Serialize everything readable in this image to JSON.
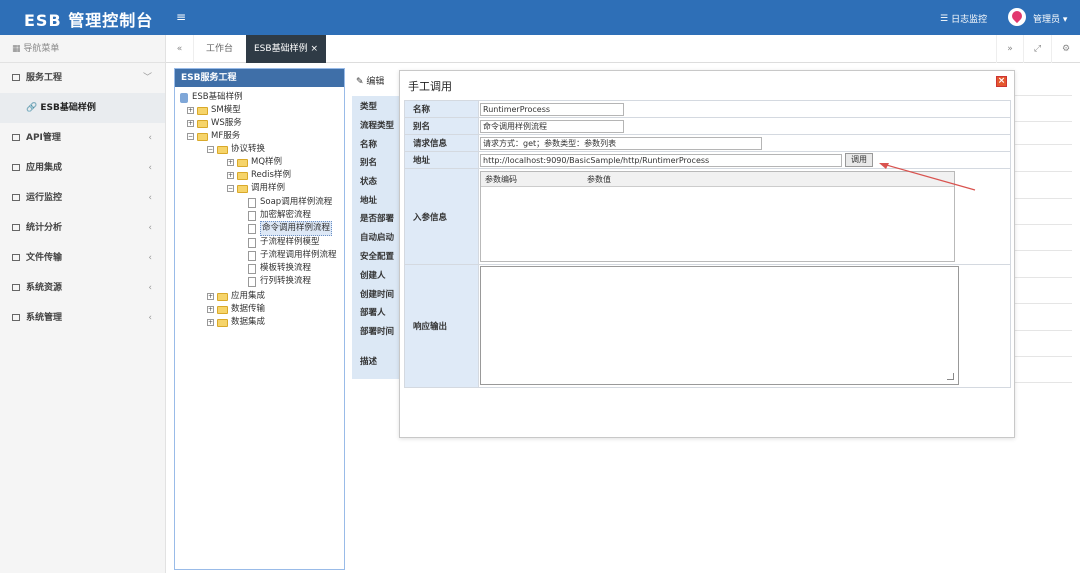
{
  "header": {
    "brand": "ESB 管理控制台",
    "menu_icon": "hamburger-icon",
    "log_link": "日志监控",
    "user_name": "管理员",
    "brand_color": "#2e6fb7"
  },
  "sidebar": {
    "title": "导航菜单",
    "items": [
      {
        "label": "服务工程",
        "arrow": "﹀",
        "icon": "folder-outline-icon"
      },
      {
        "label": "ESB基础样例",
        "icon": "link-icon",
        "sub": true
      },
      {
        "label": "API管理",
        "arrow": "‹",
        "icon": "folder-outline-icon"
      },
      {
        "label": "应用集成",
        "arrow": "‹",
        "icon": "folder-outline-icon"
      },
      {
        "label": "运行监控",
        "arrow": "‹",
        "icon": "folder-outline-icon"
      },
      {
        "label": "统计分析",
        "arrow": "‹",
        "icon": "folder-outline-icon"
      },
      {
        "label": "文件传输",
        "arrow": "‹",
        "icon": "folder-outline-icon"
      },
      {
        "label": "系统资源",
        "arrow": "‹",
        "icon": "folder-outline-icon"
      },
      {
        "label": "系统管理",
        "arrow": "‹",
        "icon": "folder-outline-icon"
      }
    ]
  },
  "tabs": {
    "prev_icon": "«",
    "next_icon": "»",
    "fullscreen_icon": "⤢",
    "settings_icon": "⚙",
    "items": [
      {
        "label": "工作台",
        "active": false
      },
      {
        "label": "ESB基础样例",
        "active": true,
        "close": "×"
      }
    ]
  },
  "tree": {
    "title": "ESB服务工程",
    "nodes": [
      {
        "label": "ESB基础样例",
        "kind": "db"
      },
      {
        "label": "SM模型",
        "kind": "folder",
        "toggle": "+"
      },
      {
        "label": "WS服务",
        "kind": "folder",
        "toggle": "+"
      },
      {
        "label": "MF服务",
        "kind": "folder",
        "toggle": "−"
      },
      {
        "label": "协议转换",
        "kind": "folder",
        "toggle": "−"
      },
      {
        "label": "MQ样例",
        "kind": "folder",
        "toggle": "+"
      },
      {
        "label": "Redis样例",
        "kind": "folder",
        "toggle": "+"
      },
      {
        "label": "调用样例",
        "kind": "folder",
        "toggle": "−"
      },
      {
        "label": "Soap调用样例流程",
        "kind": "doc"
      },
      {
        "label": "加密解密流程",
        "kind": "doc"
      },
      {
        "label": "命令调用样例流程",
        "kind": "doc",
        "selected": true
      },
      {
        "label": "子流程样例模型",
        "kind": "doc"
      },
      {
        "label": "子流程调用样例流程",
        "kind": "doc"
      },
      {
        "label": "模板转换流程",
        "kind": "doc"
      },
      {
        "label": "行列转换流程",
        "kind": "doc"
      },
      {
        "label": "应用集成",
        "kind": "folder",
        "toggle": "+"
      },
      {
        "label": "数据传输",
        "kind": "folder",
        "toggle": "+"
      },
      {
        "label": "数据集成",
        "kind": "folder",
        "toggle": "+"
      }
    ]
  },
  "detail": {
    "edit_label": "编辑",
    "props": [
      "类型",
      "流程类型",
      "名称",
      "别名",
      "状态",
      "地址",
      "是否部署",
      "自动启动",
      "安全配置",
      "创建人",
      "创建时间",
      "部署人",
      "部署时间",
      "描述"
    ]
  },
  "dialog": {
    "title": "手工调用",
    "close_icon": "×",
    "name_label": "名称",
    "name_value": "RuntimerProcess",
    "alias_label": "别名",
    "alias_value": "命令调用样例流程",
    "request_label": "请求信息",
    "request_value": "请求方式：get；参数类型：参数列表",
    "address_label": "地址",
    "address_value": "http://localhost:9090/BasicSample/http/RuntimerProcess",
    "call_button": "调用",
    "input_label": "入参信息",
    "param_col_code": "参数编码",
    "param_col_value": "参数值",
    "response_label": "响应输出",
    "response_value": ""
  },
  "colors": {
    "annotation_arrow": "#d9534f"
  }
}
